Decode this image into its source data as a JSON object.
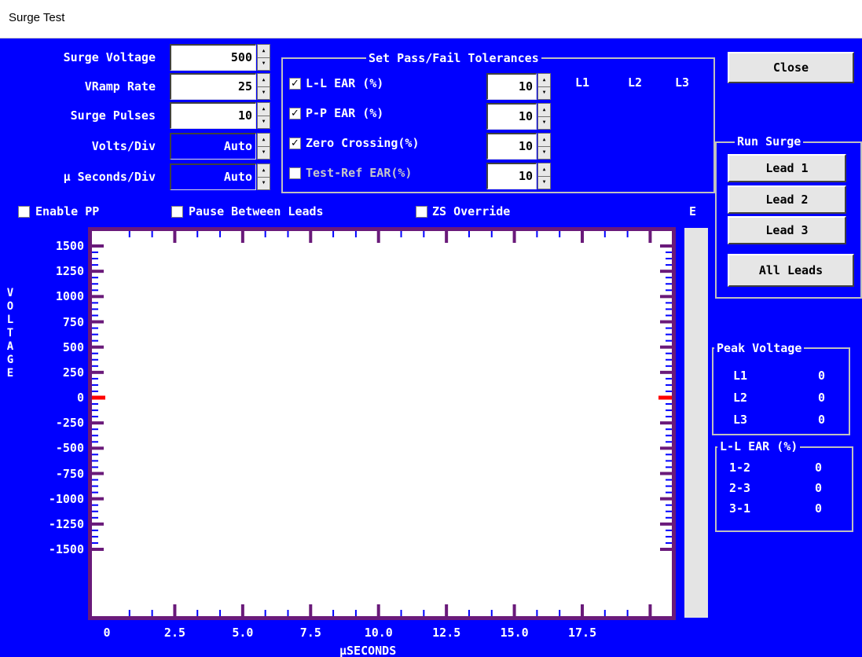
{
  "window": {
    "title": "Surge Test"
  },
  "settings": {
    "surge_voltage": {
      "label": "Surge Voltage",
      "value": "500"
    },
    "vramp_rate": {
      "label": "VRamp Rate",
      "value": "25"
    },
    "surge_pulses": {
      "label": "Surge Pulses",
      "value": "10"
    },
    "volts_div": {
      "label": "Volts/Div",
      "value": "Auto"
    },
    "useconds_div": {
      "label": "µ Seconds/Div",
      "value": "Auto"
    }
  },
  "tolerances": {
    "title": "Set Pass/Fail Tolerances",
    "rows": [
      {
        "label": "L-L EAR (%)",
        "checked": true,
        "value": "10"
      },
      {
        "label": "P-P EAR (%)",
        "checked": true,
        "value": "10"
      },
      {
        "label": "Zero Crossing(%)",
        "checked": true,
        "value": "10"
      },
      {
        "label": "Test-Ref EAR(%)",
        "checked": false,
        "value": "10"
      }
    ],
    "lead_headers": [
      "L1",
      "L2",
      "L3"
    ]
  },
  "options": {
    "enable_pp": "Enable PP",
    "pause_between_leads": "Pause Between Leads",
    "zs_override": "ZS Override",
    "e_label": "E"
  },
  "buttons": {
    "close": "Close",
    "run_surge_title": "Run Surge",
    "lead1": "Lead 1",
    "lead2": "Lead 2",
    "lead3": "Lead 3",
    "all_leads": "All Leads"
  },
  "peak_voltage": {
    "title": "Peak Voltage",
    "rows": [
      {
        "label": "L1",
        "value": "0"
      },
      {
        "label": "L2",
        "value": "0"
      },
      {
        "label": "L3",
        "value": "0"
      }
    ]
  },
  "ll_ear": {
    "title": "L-L EAR (%)",
    "rows": [
      {
        "label": "1-2",
        "value": "0"
      },
      {
        "label": "2-3",
        "value": "0"
      },
      {
        "label": "3-1",
        "value": "0"
      }
    ]
  },
  "chart_data": {
    "type": "line",
    "ylabel": "VOLTAGE",
    "xlabel": "µSECONDS",
    "y_ticks": [
      "1500",
      "1250",
      "1000",
      "750",
      "500",
      "250",
      "0",
      "-250",
      "-500",
      "-750",
      "-1000",
      "-1250",
      "-1500"
    ],
    "x_ticks": [
      "0",
      "2.5",
      "5.0",
      "7.5",
      "10.0",
      "12.5",
      "15.0",
      "17.5"
    ],
    "ylim": [
      -1500,
      1500
    ],
    "xlim": [
      0,
      17.5
    ],
    "series": [],
    "colors": {
      "background": "#ffffff",
      "frame": "#6a1a7a",
      "minor_tick": "#0000ff",
      "zero_marker": "#ff0000"
    }
  },
  "colors": {
    "client_bg": "#0000ff",
    "text": "#ffffff"
  }
}
